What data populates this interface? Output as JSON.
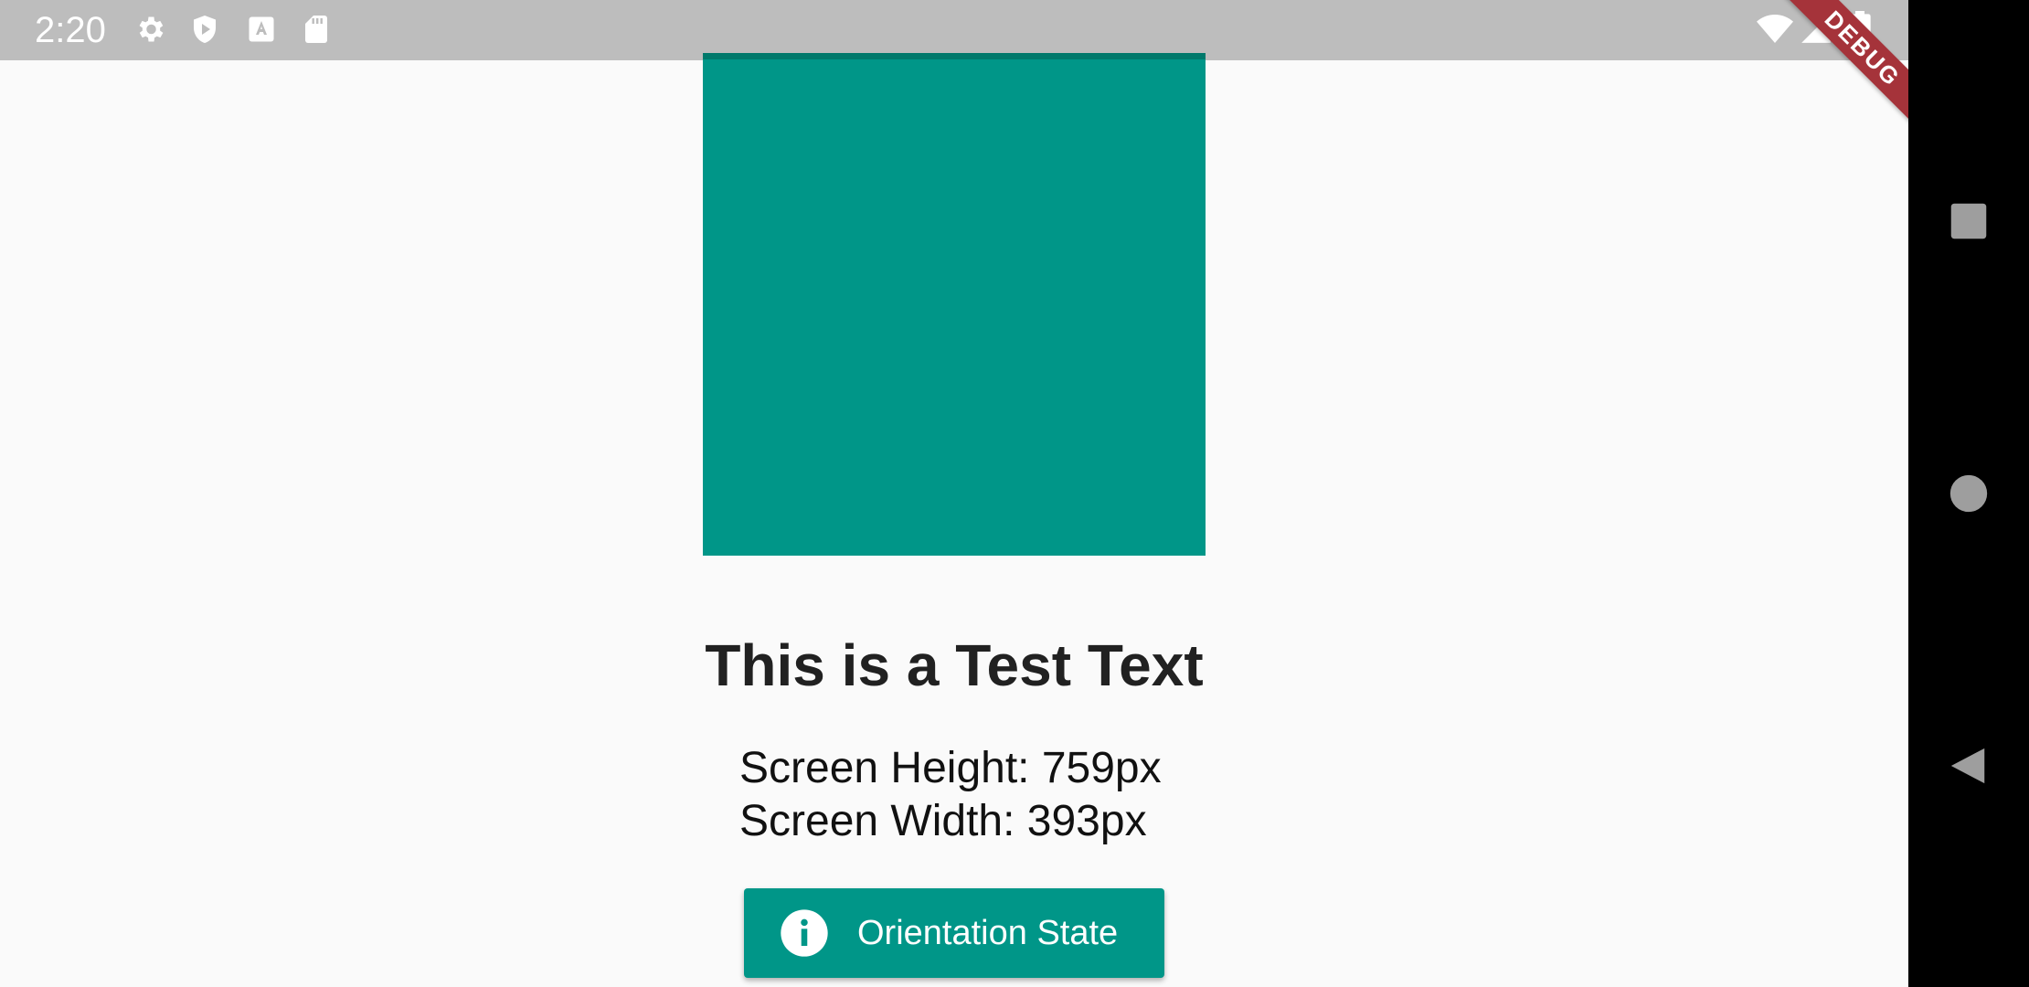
{
  "status_bar": {
    "time": "2:20",
    "icons": [
      "gear-icon",
      "play-protect-icon",
      "keyboard-a-icon",
      "sd-card-icon",
      "wifi-icon",
      "signal-icon",
      "battery-icon"
    ]
  },
  "debug_banner": "DEBUG",
  "main": {
    "title": "This is a Test Text",
    "screen_height": "Screen Height: 759px",
    "screen_width": "Screen Width: 393px",
    "button_label": "Orientation State",
    "button_icon": "info-icon"
  },
  "nav_bar": {
    "buttons": [
      "recents-square-icon",
      "home-circle-icon",
      "back-triangle-icon"
    ]
  },
  "colors": {
    "accent": "#009688",
    "accent_dark": "#00796b",
    "status_bar": "#bdbdbd",
    "background": "#fafafa",
    "debug_banner": "#a5333a"
  }
}
